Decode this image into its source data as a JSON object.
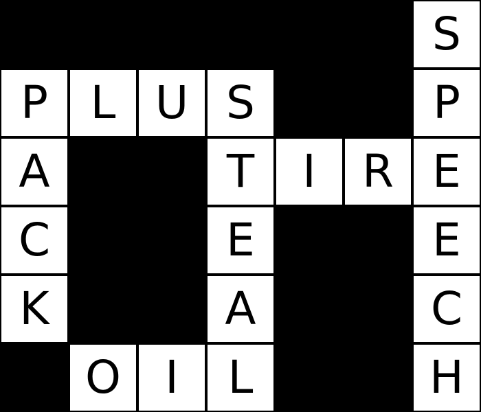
{
  "puzzle": {
    "rows": [
      [
        "#",
        "#",
        "#",
        "#",
        "#",
        "#",
        "S"
      ],
      [
        "P",
        "L",
        "U",
        "S",
        "#",
        "#",
        "P"
      ],
      [
        "A",
        "#",
        "#",
        "T",
        "I",
        "R",
        "E"
      ],
      [
        "C",
        "#",
        "#",
        "E",
        "#",
        "#",
        "E"
      ],
      [
        "K",
        "#",
        "#",
        "A",
        "#",
        "#",
        "C"
      ],
      [
        "#",
        "O",
        "I",
        "L",
        "#",
        "#",
        "H"
      ]
    ],
    "colors": {
      "block": "#000000",
      "cell": "#ffffff",
      "text": "#000000"
    }
  }
}
